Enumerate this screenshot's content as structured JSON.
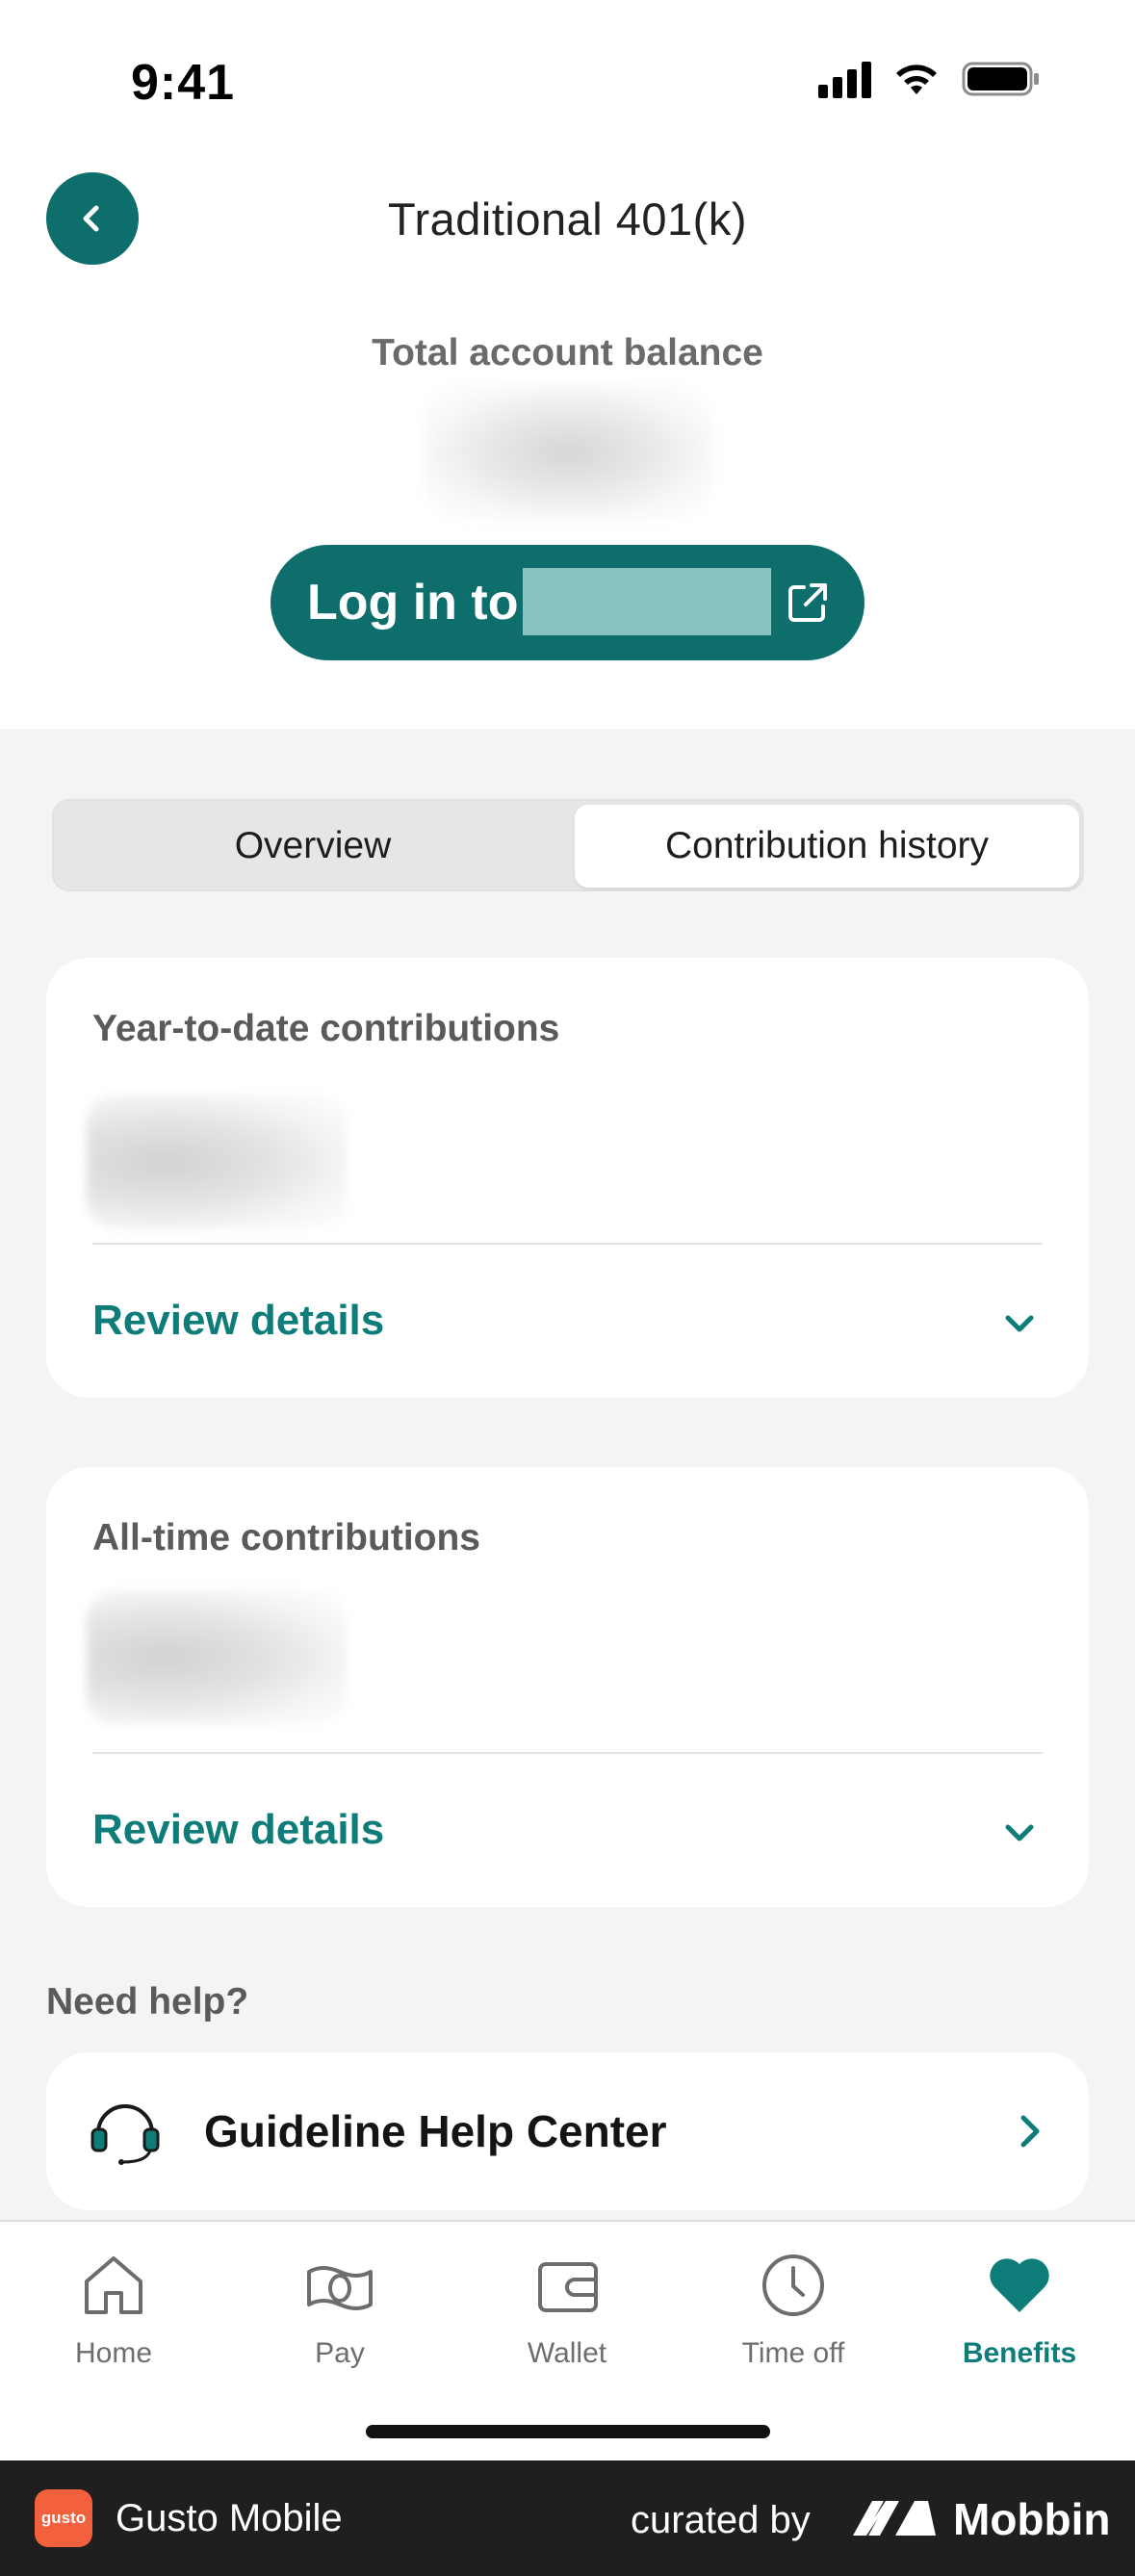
{
  "status_bar": {
    "time": "9:41"
  },
  "header": {
    "title": "Traditional 401(k)"
  },
  "balance": {
    "label": "Total account balance"
  },
  "login_button": {
    "label": "Log in to"
  },
  "segmented": {
    "tabs": [
      "Overview",
      "Contribution history"
    ],
    "selected": "Contribution history"
  },
  "cards": [
    {
      "label": "Year-to-date contributions",
      "link": "Review details"
    },
    {
      "label": "All-time contributions",
      "link": "Review details"
    }
  ],
  "help": {
    "heading": "Need help?",
    "item_label": "Guideline Help Center"
  },
  "tabbar": {
    "items": [
      {
        "label": "Home",
        "icon": "home-icon"
      },
      {
        "label": "Pay",
        "icon": "money-icon"
      },
      {
        "label": "Wallet",
        "icon": "wallet-icon"
      },
      {
        "label": "Time off",
        "icon": "clock-icon"
      },
      {
        "label": "Benefits",
        "icon": "heart-icon"
      }
    ],
    "active": "Benefits"
  },
  "footer": {
    "logo_text": "gusto",
    "app_name": "Gusto Mobile",
    "curated_by": "curated by",
    "brand": "Mobbin"
  },
  "colors": {
    "accent": "#0e6e6b",
    "link": "#0e7c78",
    "background": "#f4f4f2"
  }
}
